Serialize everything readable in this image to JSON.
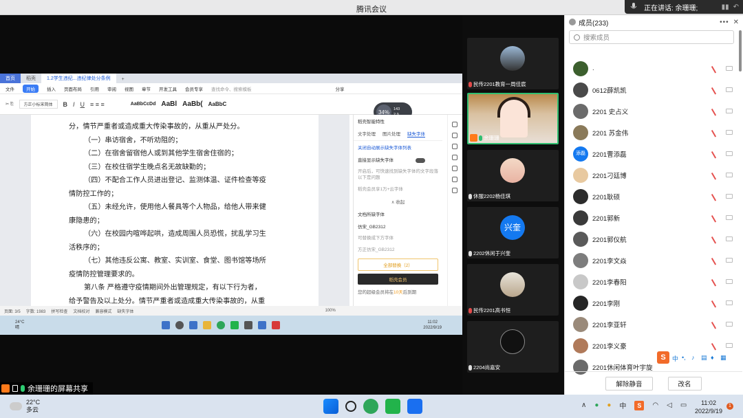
{
  "window": {
    "title": "腾讯会议"
  },
  "speaking": {
    "label": "正在讲话: 余珊珊;"
  },
  "shared": {
    "tabs": [
      {
        "label": "首页"
      },
      {
        "label": "稻壳"
      },
      {
        "label": "1.2学生违纪...违纪律处分条例"
      }
    ],
    "menus": [
      "文件",
      "开始",
      "插入",
      "页面布局",
      "引用",
      "审阅",
      "视图",
      "章节",
      "开发工具",
      "会员专享"
    ],
    "menu_active": "开始",
    "search_placeholder": "查找命令、搜索模板",
    "share_btn": "分享",
    "styles": [
      "AaBbCcDd",
      "AaBl",
      "AaBb(",
      "AaBbC"
    ],
    "style_names": [
      "正文",
      "标题 1",
      "标题 2",
      "标题 3"
    ],
    "timer": {
      "value": "34%",
      "up": "143",
      "down": "2.9"
    },
    "doc_lines": [
      "分，情节严重者或造成重大传染事故的，从重从严处分。",
      "（一）串访宿舍，不听劝阻的；",
      "（二）在宿舍留宿他人或到其他学生宿舍住宿的；",
      "（三）在校住宿学生晚点名无故缺勤的；",
      "（四）不配合工作人员进出登记、监测体温、证件检查等疫",
      "情防控工作的；",
      "（五）未经允许，使用他人餐具等个人物品，给他人带来健",
      "康隐患的；",
      "（六）在校园内喧哗起哄，造成周围人员恐慌，扰乱学习生",
      "活秩序的；",
      "（七）其他违反公寓、教室、实训室、食堂、图书馆等场所",
      "疫情防控管理要求的。",
      "第八条 严格遵守疫情期间外出管理规定，有以下行为者，",
      "给予警告及以上处分。情节严重者或造成重大传染事故的，从重"
    ],
    "side": {
      "title": "稻壳智能特性",
      "tabs": [
        "文字处理",
        "图片处理",
        "缺失字体"
      ],
      "active_tab": "缺失字体",
      "link": "关闭自动展示缺失字体列表",
      "toggle_label": "直接显示缺失字体",
      "desc": "开启后，可快速找到缺失字体的文字段落以下是问题",
      "count": "稻壳会员享1万+云字体",
      "collapse": "∧ 收起",
      "font_section": "文档所缺字体",
      "font1": "仿宋_GB2312",
      "font1_note": "可替换成下方字体",
      "font2": "方正仿宋_GB2312",
      "btn_all": "全部替换（2）",
      "btn_vip": "稻壳会员",
      "note_pre": "您的超级会员将在",
      "note_days": "10天",
      "note_post": "后到期"
    },
    "status": [
      "页面: 3/5",
      "字数: 1983",
      "拼写检查",
      "文档校对",
      "兼容模式",
      "缺失字体"
    ],
    "zoom": "100%",
    "inner_weather": {
      "temp": "24°C",
      "desc": "晴"
    },
    "inner_clock": {
      "time": "11:02",
      "date": "2022/9/19"
    }
  },
  "share_label": "余珊珊的屏幕共享",
  "videos": [
    {
      "name": "民传2201教育一周佳宸",
      "mic_muted": true
    },
    {
      "name": "余珊珊",
      "mic_muted": false
    },
    {
      "name": "休服2202杨佳琪",
      "mic_muted": false
    },
    {
      "name": "2202休闲于兴奎",
      "mic_muted": false,
      "avatar_text": "兴奎"
    },
    {
      "name": "民传2201高书恒",
      "mic_muted": true
    },
    {
      "name": "2204尚嘉安",
      "mic_muted": false
    }
  ],
  "members": {
    "title": "成员(233)",
    "search_placeholder": "搜索成员",
    "list": [
      {
        "name": "."
      },
      {
        "name": "0612薛凯凯"
      },
      {
        "name": "2201  史占义"
      },
      {
        "name": "2201  苏金伟"
      },
      {
        "name": "2201曹添磊",
        "avatar_text": "添磊"
      },
      {
        "name": "2201刁廷博"
      },
      {
        "name": "2201耿硕"
      },
      {
        "name": "2201郭新"
      },
      {
        "name": "2201郭仪航"
      },
      {
        "name": "2201李文焱"
      },
      {
        "name": "2201李春阳"
      },
      {
        "name": "2201李刚"
      },
      {
        "name": "2201李亚轩"
      },
      {
        "name": "2201李义豪"
      },
      {
        "name": "2201休闲体育叶宇旋"
      }
    ],
    "unmute_all": "解除静音",
    "rename": "改名"
  },
  "taskbar": {
    "weather_temp": "22°C",
    "weather_desc": "多云",
    "ime": "中",
    "time": "11:02",
    "date": "2022/9/19",
    "notif_count": "1"
  }
}
